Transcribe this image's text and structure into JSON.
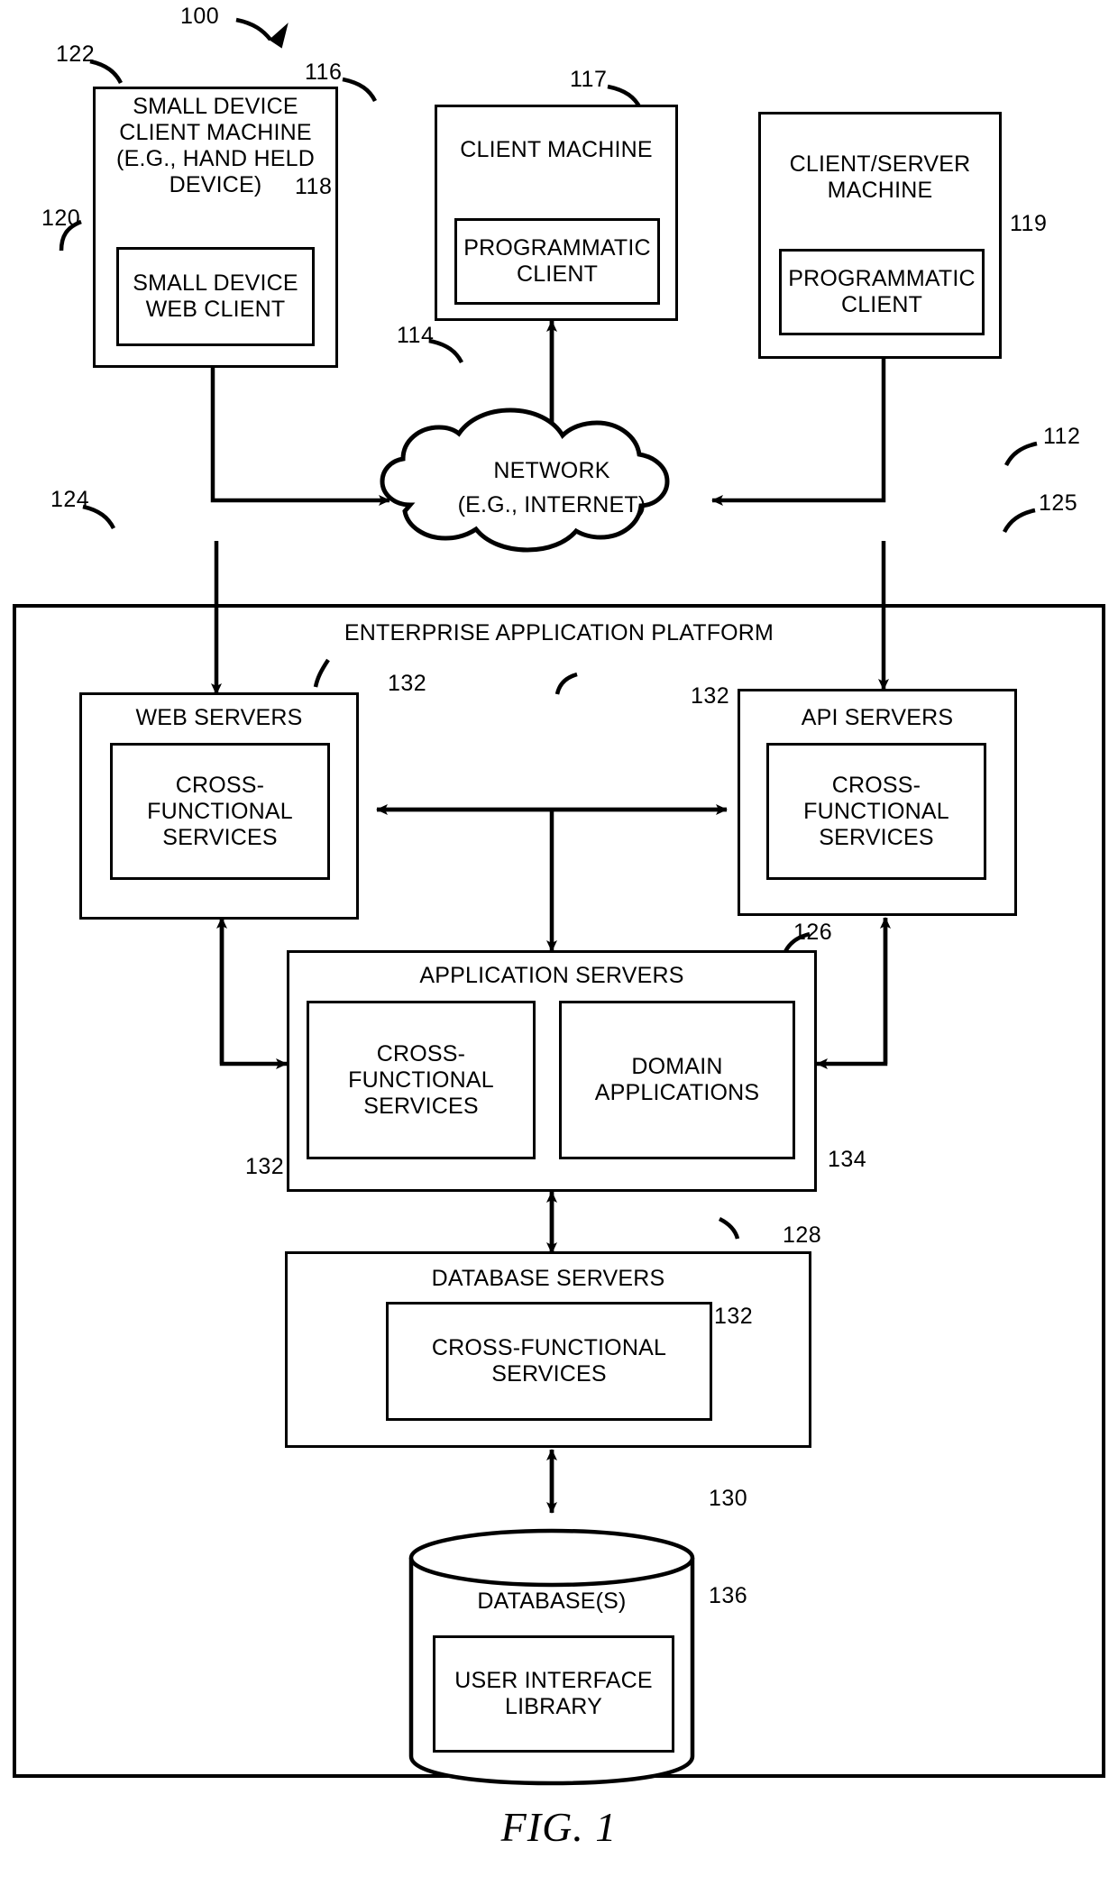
{
  "figure": {
    "caption": "FIG. 1",
    "system_ref": "100"
  },
  "clients": [
    {
      "ref": "122",
      "title": "SMALL DEVICE\nCLIENT MACHINE\n(E.G., HAND HELD\nDEVICE)",
      "inner": {
        "ref": "120",
        "title": "SMALL DEVICE\nWEB CLIENT"
      }
    },
    {
      "ref": "116",
      "title": "CLIENT MACHINE",
      "inner": {
        "ref": "118",
        "title": "PROGRAMMATIC\nCLIENT"
      }
    },
    {
      "ref": "117",
      "title": "CLIENT/SERVER\nMACHINE",
      "inner": {
        "ref": "119",
        "title": "PROGRAMMATIC\nCLIENT"
      }
    }
  ],
  "network": {
    "ref": "114",
    "line1": "NETWORK",
    "line2": "(E.G., INTERNET)"
  },
  "platform": {
    "ref": "112",
    "title": "ENTERPRISE APPLICATION PLATFORM"
  },
  "servers": {
    "web": {
      "ref": "124",
      "title": "WEB SERVERS",
      "inner": {
        "ref": "132",
        "title": "CROSS-\nFUNCTIONAL\nSERVICES"
      }
    },
    "api": {
      "ref": "125",
      "title": "API SERVERS",
      "inner": {
        "ref": "132",
        "title": "CROSS-\nFUNCTIONAL\nSERVICES"
      }
    },
    "application": {
      "ref": "126",
      "title": "APPLICATION SERVERS",
      "inner_left": {
        "ref": "132",
        "title": "CROSS-\nFUNCTIONAL\nSERVICES"
      },
      "inner_right": {
        "ref": "134",
        "title": "DOMAIN\nAPPLICATIONS"
      }
    },
    "database": {
      "ref": "128",
      "title": "DATABASE SERVERS",
      "inner": {
        "ref": "132",
        "title": "CROSS-FUNCTIONAL\nSERVICES"
      }
    }
  },
  "database_store": {
    "ref": "130",
    "title": "DATABASE(S)",
    "inner": {
      "ref": "136",
      "title": "USER INTERFACE\nLIBRARY"
    }
  }
}
